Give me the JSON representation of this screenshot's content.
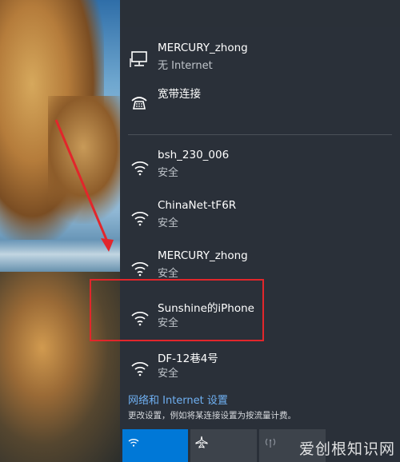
{
  "networks": {
    "wired": {
      "name": "MERCURY_zhong",
      "status": "无 Internet"
    },
    "dialup": {
      "name": "宽带连接"
    },
    "wifi": [
      {
        "name": "bsh_230_006",
        "security": "安全"
      },
      {
        "name": "ChinaNet-tF6R",
        "security": "安全"
      },
      {
        "name": "MERCURY_zhong",
        "security": "安全"
      },
      {
        "name": "Sunshine的iPhone",
        "security": "安全"
      },
      {
        "name": "DF-12巷4号",
        "security": "安全"
      }
    ]
  },
  "settings": {
    "title": "网络和 Internet 设置",
    "description": "更改设置，例如将某连接设置为按流量计费。"
  },
  "colors": {
    "accent": "#0078d7",
    "highlight_box": "#e2262b",
    "link": "#6fb0f2"
  },
  "watermark": "爱创根知识网"
}
